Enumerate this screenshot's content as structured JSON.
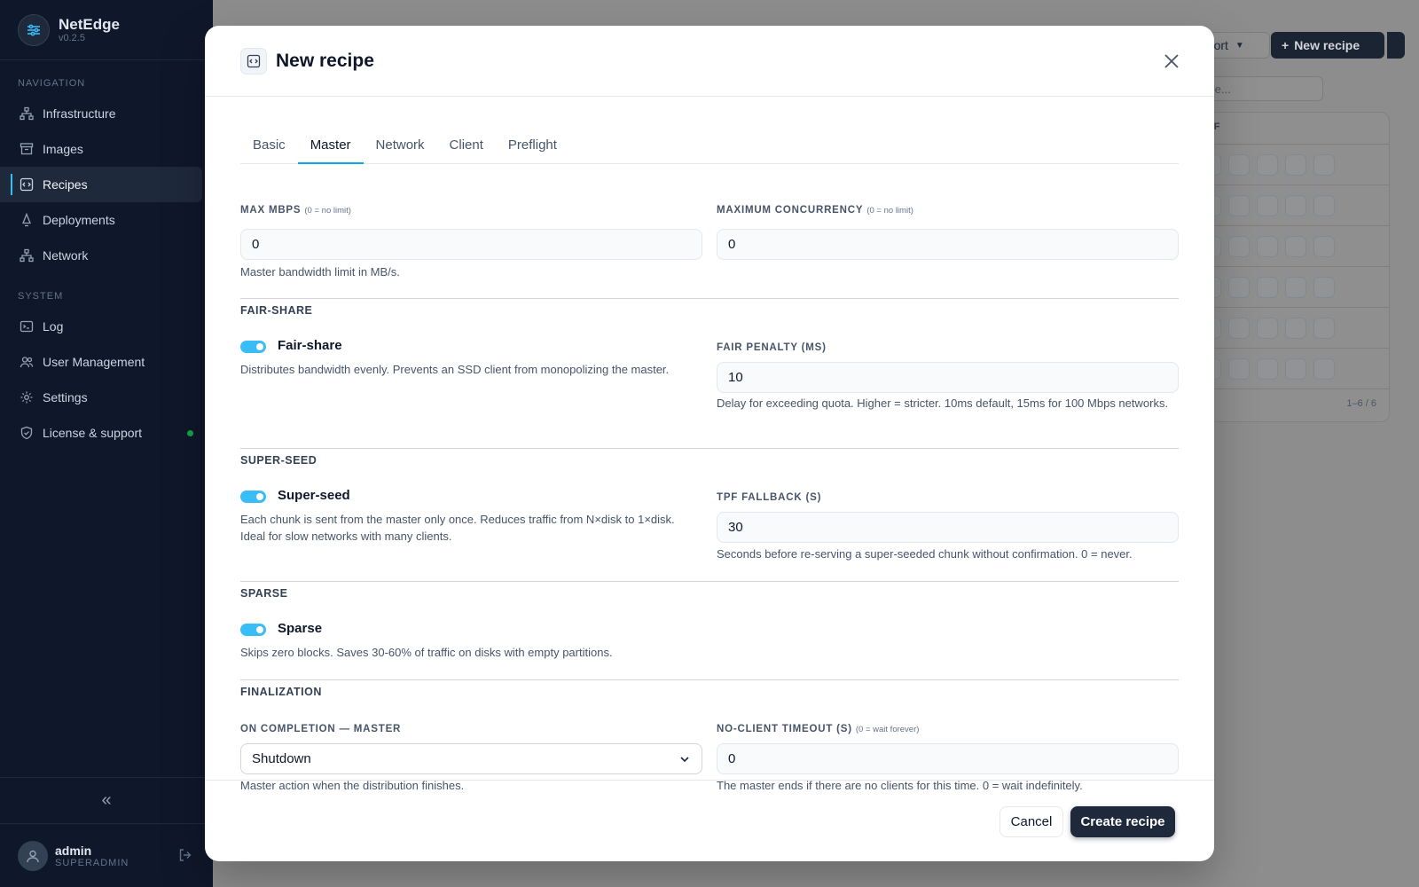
{
  "app": {
    "name": "NetEdge",
    "version": "v0.2.5"
  },
  "sidebar": {
    "navigation_title": "NAVIGATION",
    "system_title": "SYSTEM",
    "nav_items": [
      {
        "label": "Infrastructure",
        "icon": "hierarchy-icon"
      },
      {
        "label": "Images",
        "icon": "archive-icon"
      },
      {
        "label": "Recipes",
        "icon": "recipe-icon",
        "active": true
      },
      {
        "label": "Deployments",
        "icon": "rocket-icon"
      },
      {
        "label": "Network",
        "icon": "network-icon"
      }
    ],
    "system_items": [
      {
        "label": "Log",
        "icon": "terminal-icon"
      },
      {
        "label": "User Management",
        "icon": "users-icon"
      },
      {
        "label": "Settings",
        "icon": "gear-icon"
      },
      {
        "label": "License & support",
        "icon": "shield-icon",
        "status_color": "#16a34a"
      }
    ],
    "collapse_glyph": "«",
    "user": {
      "name": "admin",
      "role": "SUPERADMIN"
    }
  },
  "background": {
    "import_label": "nport",
    "new_recipe_label": "New recipe",
    "search_placeholder": "cipe...",
    "table_header": "DIFF",
    "pagination": "1–6 / 6"
  },
  "modal": {
    "title": "New recipe",
    "tabs": [
      "Basic",
      "Master",
      "Network",
      "Client",
      "Preflight"
    ],
    "active_tab": "Master",
    "max_mbps": {
      "label": "MAX MBPS",
      "hint": "(0 = no limit)",
      "value": "0",
      "help": "Master bandwidth limit in MB/s."
    },
    "max_concurrency": {
      "label": "MAXIMUM CONCURRENCY",
      "hint": "(0 = no limit)",
      "value": "0"
    },
    "fair_share": {
      "section": "FAIR-SHARE",
      "toggle_label": "Fair-share",
      "enabled": true,
      "help": "Distributes bandwidth evenly. Prevents an SSD client from monopolizing the master.",
      "penalty_label": "FAIR PENALTY (MS)",
      "penalty_value": "10",
      "penalty_help": "Delay for exceeding quota. Higher = stricter. 10ms default, 15ms for 100 Mbps networks."
    },
    "super_seed": {
      "section": "SUPER-SEED",
      "toggle_label": "Super-seed",
      "enabled": true,
      "help": "Each chunk is sent from the master only once. Reduces traffic from N×disk to 1×disk. Ideal for slow networks with many clients.",
      "fallback_label": "TPF FALLBACK (S)",
      "fallback_value": "30",
      "fallback_help": "Seconds before re-serving a super-seeded chunk without confirmation. 0 = never."
    },
    "sparse": {
      "section": "SPARSE",
      "toggle_label": "Sparse",
      "enabled": true,
      "help": "Skips zero blocks. Saves 30-60% of traffic on disks with empty partitions."
    },
    "finalization": {
      "section": "FINALIZATION",
      "completion_label": "ON COMPLETION — MASTER",
      "completion_value": "Shutdown",
      "completion_help": "Master action when the distribution finishes.",
      "timeout_label": "NO-CLIENT TIMEOUT (S)",
      "timeout_hint": "(0 = wait forever)",
      "timeout_value": "0",
      "timeout_help": "The master ends if there are no clients for this time. 0 = wait indefinitely."
    },
    "cancel_label": "Cancel",
    "create_label": "Create recipe"
  },
  "colors": {
    "accent": "#38bdf8",
    "primary": "#1e293b",
    "sidebar_bg": "#0f172a"
  }
}
